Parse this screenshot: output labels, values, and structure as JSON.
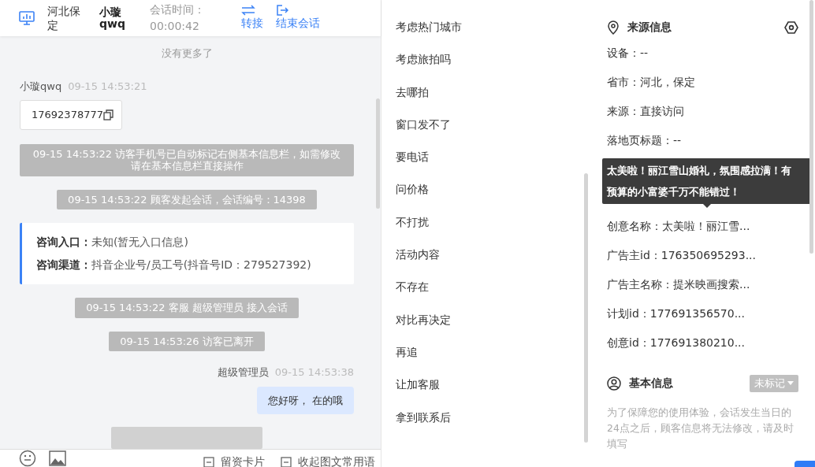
{
  "header": {
    "location": "河北保定",
    "visitor_name": "小璇qwq",
    "session_time_label": "会话时间：",
    "session_time": "00:00:42",
    "actions": [
      {
        "kind": "transfer",
        "label": "转接"
      },
      {
        "kind": "exit",
        "label": "结束会话"
      }
    ]
  },
  "chat": {
    "messages": [
      {
        "kind": "notice",
        "text": "没有更多了"
      },
      {
        "kind": "visitor",
        "sender": "小璇qwq",
        "time": "09-15 14:53:21",
        "text": "17692378777"
      },
      {
        "kind": "system",
        "text": "09-15 14:53:22 访客手机号已自动标记右侧基本信息栏，如需修改请在基本信息栏直接操作"
      },
      {
        "kind": "system",
        "text": "09-15 14:53:22 顾客发起会话，会话编号：14398"
      },
      {
        "kind": "entry",
        "rows": [
          {
            "label": "咨询入口：",
            "value": "未知(暂无入口信息)"
          },
          {
            "label": "咨询渠道：",
            "value": "抖音企业号/员工号(抖音号ID：279527392)"
          }
        ]
      },
      {
        "kind": "system",
        "text": "09-15 14:53:22 客服 超级管理员 接入会话"
      },
      {
        "kind": "system",
        "text": "09-15 14:53:26 访客已离开"
      },
      {
        "kind": "agent",
        "sender": "超级管理员",
        "time": "09-15 14:53:38",
        "text": "您好呀， 在的哦"
      }
    ]
  },
  "composer": {
    "tools": [
      {
        "kind": "emoji"
      },
      {
        "kind": "image"
      }
    ],
    "options": [
      {
        "label": "留资卡片"
      },
      {
        "label": "收起图文常用语"
      }
    ]
  },
  "quick_replies": [
    "考虑热门城市",
    "考虑旅拍吗",
    "去哪拍",
    "窗口发不了",
    "要电话",
    "问价格",
    "不打扰",
    "活动内容",
    "不存在",
    "对比再决定",
    "再追",
    "让加客服",
    "拿到联系后"
  ],
  "source_info": {
    "title": "来源信息",
    "rows": [
      {
        "label": "设备：",
        "value": "--"
      },
      {
        "label": "省市：",
        "value": "河北，保定"
      },
      {
        "label": "来源：",
        "value": "直接访问"
      },
      {
        "label": "落地页标题：",
        "value": "--"
      },
      {
        "label": "创意名称：",
        "value": "太美啦！丽江雪..."
      },
      {
        "label": "广告主id：",
        "value": "176350695293..."
      },
      {
        "label": "广告主名称：",
        "value": "提米映画搜索..."
      },
      {
        "label": "计划id：",
        "value": "177691356570..."
      },
      {
        "label": "创意id：",
        "value": "177691380210..."
      }
    ],
    "tooltip": "太美啦！丽江雪山婚礼，氛围感拉满！有预算的小富婆千万不能错过！"
  },
  "basic_info": {
    "title": "基本信息",
    "tag": "未标记",
    "note": "为了保障您的使用体验，会话发生当日的24点之后，顾客信息将无法修改，请及时填写"
  }
}
